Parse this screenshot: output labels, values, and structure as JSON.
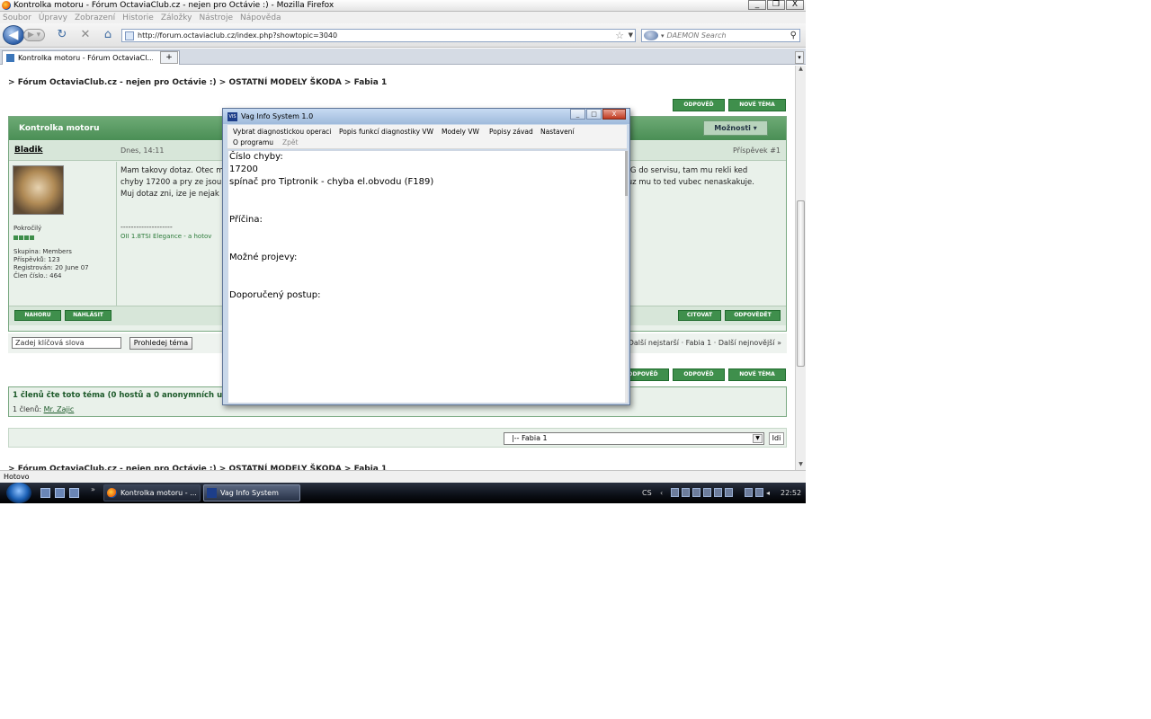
{
  "browser": {
    "window_title": "Kontrolka motoru - Fórum OctaviaClub.cz - nejen pro Octávie :) - Mozilla Firefox",
    "window_buttons": [
      "_",
      "❐",
      "X"
    ],
    "menu": [
      "Soubor",
      "Úpravy",
      "Zobrazení",
      "Historie",
      "Záložky",
      "Nástroje",
      "Nápověda"
    ],
    "url": "http://forum.octaviaclub.cz/index.php?showtopic=3040",
    "search_placeholder": "DAEMON Search",
    "tab_label": "Kontrolka motoru - Fórum OctaviaCl...",
    "new_tab": "+",
    "status": "Hotovo"
  },
  "forum": {
    "breadcrumb_prefix": "> ",
    "breadcrumb": "Fórum OctaviaClub.cz - nejen pro Octávie :) > OSTATNÍ MODELY ŠKODA > Fabia 1",
    "reply_btn": "ODPOVĚĎ",
    "new_topic_btn": "NOVÉ TÉMA",
    "quick_reply_btn": "ODPOVĚĎ",
    "topic_title": "Kontrolka motoru",
    "options_btn": "Možnosti ▾",
    "author": "Bladik",
    "post_date": "Dnes, 14:11",
    "post_num": "Příspěvek #1",
    "user_group_rank": "Pokročilý",
    "pips": 4,
    "side_lines": [
      "Skupina: Members",
      "Příspěvků: 123",
      "Registrován: 20 June 07",
      "Člen číslo.: 464"
    ],
    "post_text": [
      "Mam takovy dotaz. Otec m",
      "chyby 17200 a pry ze jsou",
      "Muj dotaz zni, ize je nejak"
    ],
    "post_text_right": [
      "VAG do servisu, tam mu rekli ked",
      "y uz mu to ted vubec nenaskakuje."
    ],
    "signature_line": "--------------------",
    "signature": "OII 1.8TSI Elegance - a hotov",
    "top_btn": "NAHORU",
    "report_btn": "NAHLÁSIT",
    "quote_btn": "CITOVAT",
    "send_reply_btn": "ODPOVĚDĚT",
    "keywords_placeholder": "Zadej klíčová slova",
    "search_topic_btn": "Prohledej téma",
    "nav_links": "Další nejstarší · Fabia 1 · Další nejnovější »",
    "readers_line": "1 členů čte toto téma (0 hostů a 0 anonymních uživ",
    "readers_members_label": "1 členů:",
    "readers_member": "Mr. Zajic",
    "jump_value": "|-- Fabia 1",
    "go_btn": "Idi"
  },
  "vag": {
    "title": "Vag Info System 1.0",
    "icon_label": "VIS",
    "buttons": [
      "_",
      "□",
      "X"
    ],
    "menu": [
      "Vybrat diagnostickou operaci",
      "Popis funkcí diagnostiky VW",
      "Modely VW",
      "Popisy závad",
      "Nastavení",
      "O programu",
      "Zpět"
    ],
    "lines": {
      "label_code": "Číslo chyby:",
      "code": "17200",
      "description": "spínač pro Tiptronik - chyba el.obvodu (F189)",
      "cause": "Příčina:",
      "symptoms": "Možné projevy:",
      "procedure": "Doporučený postup:"
    }
  },
  "taskbar": {
    "task1": "Kontrolka motoru - ...",
    "task2": "Vag Info System",
    "lang": "CS",
    "clock": "22:52"
  }
}
